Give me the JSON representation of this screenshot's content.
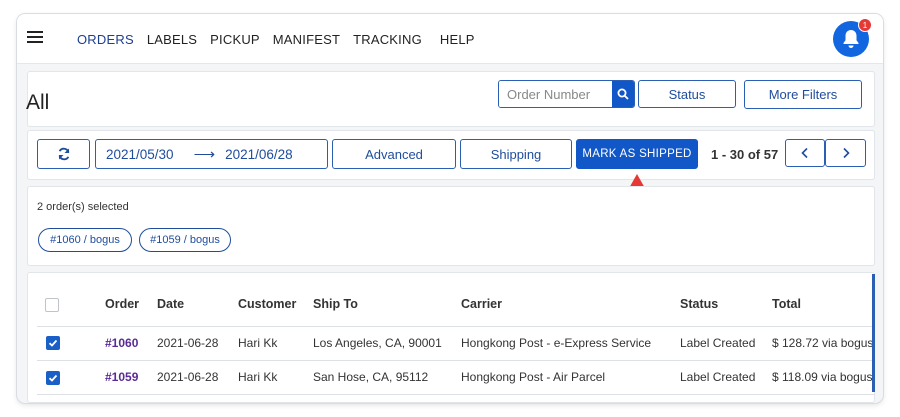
{
  "nav": {
    "items": [
      "ORDERS",
      "LABELS",
      "PICKUP",
      "MANIFEST",
      "TRACKING",
      "HELP"
    ],
    "notification_count": "1"
  },
  "header": {
    "title": "All",
    "search_placeholder": "Order Number",
    "status_label": "Status",
    "more_filters_label": "More Filters"
  },
  "toolbar": {
    "date_from": "2021/05/30",
    "date_to": "2021/06/28",
    "advanced_label": "Advanced",
    "shipping_label": "Shipping",
    "mark_shipped_label": "MARK AS SHIPPED",
    "pager_text": "1 - 30 of 57"
  },
  "selection": {
    "summary": "2 order(s) selected",
    "chips": [
      "#1060 / bogus",
      "#1059 / bogus"
    ]
  },
  "table": {
    "headers": [
      "Order",
      "Date",
      "Customer",
      "Ship To",
      "Carrier",
      "Status",
      "Total"
    ],
    "rows": [
      {
        "order": "#1060",
        "date": "2021-06-28",
        "customer": "Hari Kk",
        "ship_to": "Los Angeles, CA, 90001",
        "carrier": "Hongkong Post - e-Express Service",
        "status": "Label Created",
        "total": "$ 128.72 via bogus"
      },
      {
        "order": "#1059",
        "date": "2021-06-28",
        "customer": "Hari Kk",
        "ship_to": "San Hose, CA, 95112",
        "carrier": "Hongkong Post - Air Parcel",
        "status": "Label Created",
        "total": "$ 118.09 via bogus"
      }
    ]
  },
  "colors": {
    "accent": "#1257c7",
    "nav_active": "#1d3f8f",
    "order_link": "#5a2b94",
    "annotation_arrow": "#e53935",
    "badge": "#e53935"
  }
}
